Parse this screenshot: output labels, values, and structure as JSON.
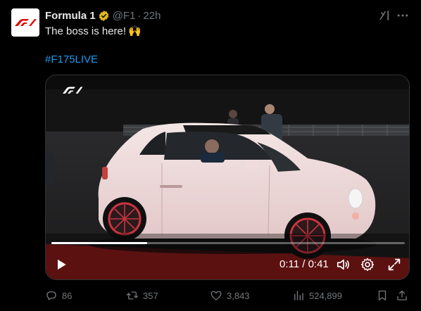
{
  "author": {
    "name": "Formula 1",
    "handle": "@F1",
    "separator": "·",
    "time": "22h",
    "verified": true
  },
  "tweet": {
    "text": "The boss is here!",
    "emoji": "🙌",
    "hashtag": "#F175LIVE"
  },
  "video": {
    "watermark": "F1",
    "current_time": "0:11",
    "duration": "0:41",
    "time_display": "0:11 / 0:41",
    "progress_fraction": 0.27
  },
  "actions": {
    "replies": "86",
    "reposts": "357",
    "likes": "3,843",
    "views": "524,899"
  },
  "colors": {
    "background": "#000000",
    "text": "#e7e9ea",
    "muted": "#71767b",
    "link": "#1d9bf0",
    "f1_red": "#e10600",
    "verified_gold": "#e2b719"
  },
  "icons": [
    "grok-icon",
    "more-icon",
    "play-icon",
    "volume-icon",
    "settings-icon",
    "fullscreen-icon",
    "reply-icon",
    "repost-icon",
    "like-icon",
    "views-icon",
    "bookmark-icon",
    "share-icon",
    "verified-icon",
    "f1-logo"
  ]
}
